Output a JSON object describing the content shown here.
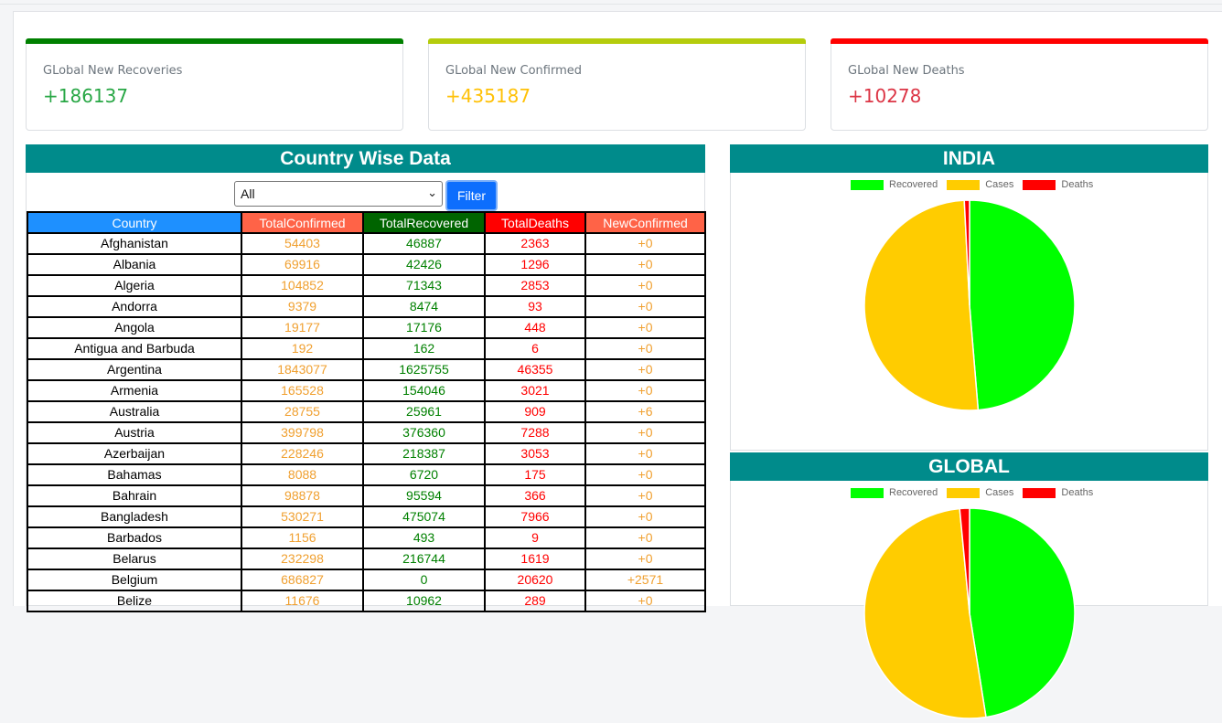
{
  "cards": [
    {
      "label": "GLobal New Recoveries",
      "value": "+186137",
      "color": "#28a745",
      "bar": "#008000"
    },
    {
      "label": "GLobal New Confirmed",
      "value": "+435187",
      "color": "#ffc107",
      "bar": "#b5cc0c"
    },
    {
      "label": "GLobal New Deaths",
      "value": "+10278",
      "color": "#dc3545",
      "bar": "#ff0000"
    }
  ],
  "country_section": {
    "title": "Country Wise Data",
    "select_value": "All",
    "filter_label": "Filter",
    "columns": [
      {
        "label": "Country",
        "bg": "#1e90ff"
      },
      {
        "label": "TotalConfirmed",
        "bg": "#ff6347"
      },
      {
        "label": "TotalRecovered",
        "bg": "#006400"
      },
      {
        "label": "TotalDeaths",
        "bg": "#ff0000"
      },
      {
        "label": "NewConfirmed",
        "bg": "#ff6347"
      }
    ],
    "rows": [
      [
        "Afghanistan",
        "54403",
        "46887",
        "2363",
        "+0"
      ],
      [
        "Albania",
        "69916",
        "42426",
        "1296",
        "+0"
      ],
      [
        "Algeria",
        "104852",
        "71343",
        "2853",
        "+0"
      ],
      [
        "Andorra",
        "9379",
        "8474",
        "93",
        "+0"
      ],
      [
        "Angola",
        "19177",
        "17176",
        "448",
        "+0"
      ],
      [
        "Antigua and Barbuda",
        "192",
        "162",
        "6",
        "+0"
      ],
      [
        "Argentina",
        "1843077",
        "1625755",
        "46355",
        "+0"
      ],
      [
        "Armenia",
        "165528",
        "154046",
        "3021",
        "+0"
      ],
      [
        "Australia",
        "28755",
        "25961",
        "909",
        "+6"
      ],
      [
        "Austria",
        "399798",
        "376360",
        "7288",
        "+0"
      ],
      [
        "Azerbaijan",
        "228246",
        "218387",
        "3053",
        "+0"
      ],
      [
        "Bahamas",
        "8088",
        "6720",
        "175",
        "+0"
      ],
      [
        "Bahrain",
        "98878",
        "95594",
        "366",
        "+0"
      ],
      [
        "Bangladesh",
        "530271",
        "475074",
        "7966",
        "+0"
      ],
      [
        "Barbados",
        "1156",
        "493",
        "9",
        "+0"
      ],
      [
        "Belarus",
        "232298",
        "216744",
        "1619",
        "+0"
      ],
      [
        "Belgium",
        "686827",
        "0",
        "20620",
        "+2571"
      ],
      [
        "Belize",
        "11676",
        "10962",
        "289",
        "+0"
      ]
    ]
  },
  "legend": [
    {
      "label": "Recovered",
      "color": "#00ff00"
    },
    {
      "label": "Cases",
      "color": "#ffcc00"
    },
    {
      "label": "Deaths",
      "color": "#ff0000"
    }
  ],
  "pies": [
    {
      "title": "INDIA",
      "fractions": [
        0.487,
        0.505,
        0.008
      ]
    },
    {
      "title": "GLOBAL",
      "fractions": [
        0.475,
        0.51,
        0.015
      ]
    }
  ]
}
